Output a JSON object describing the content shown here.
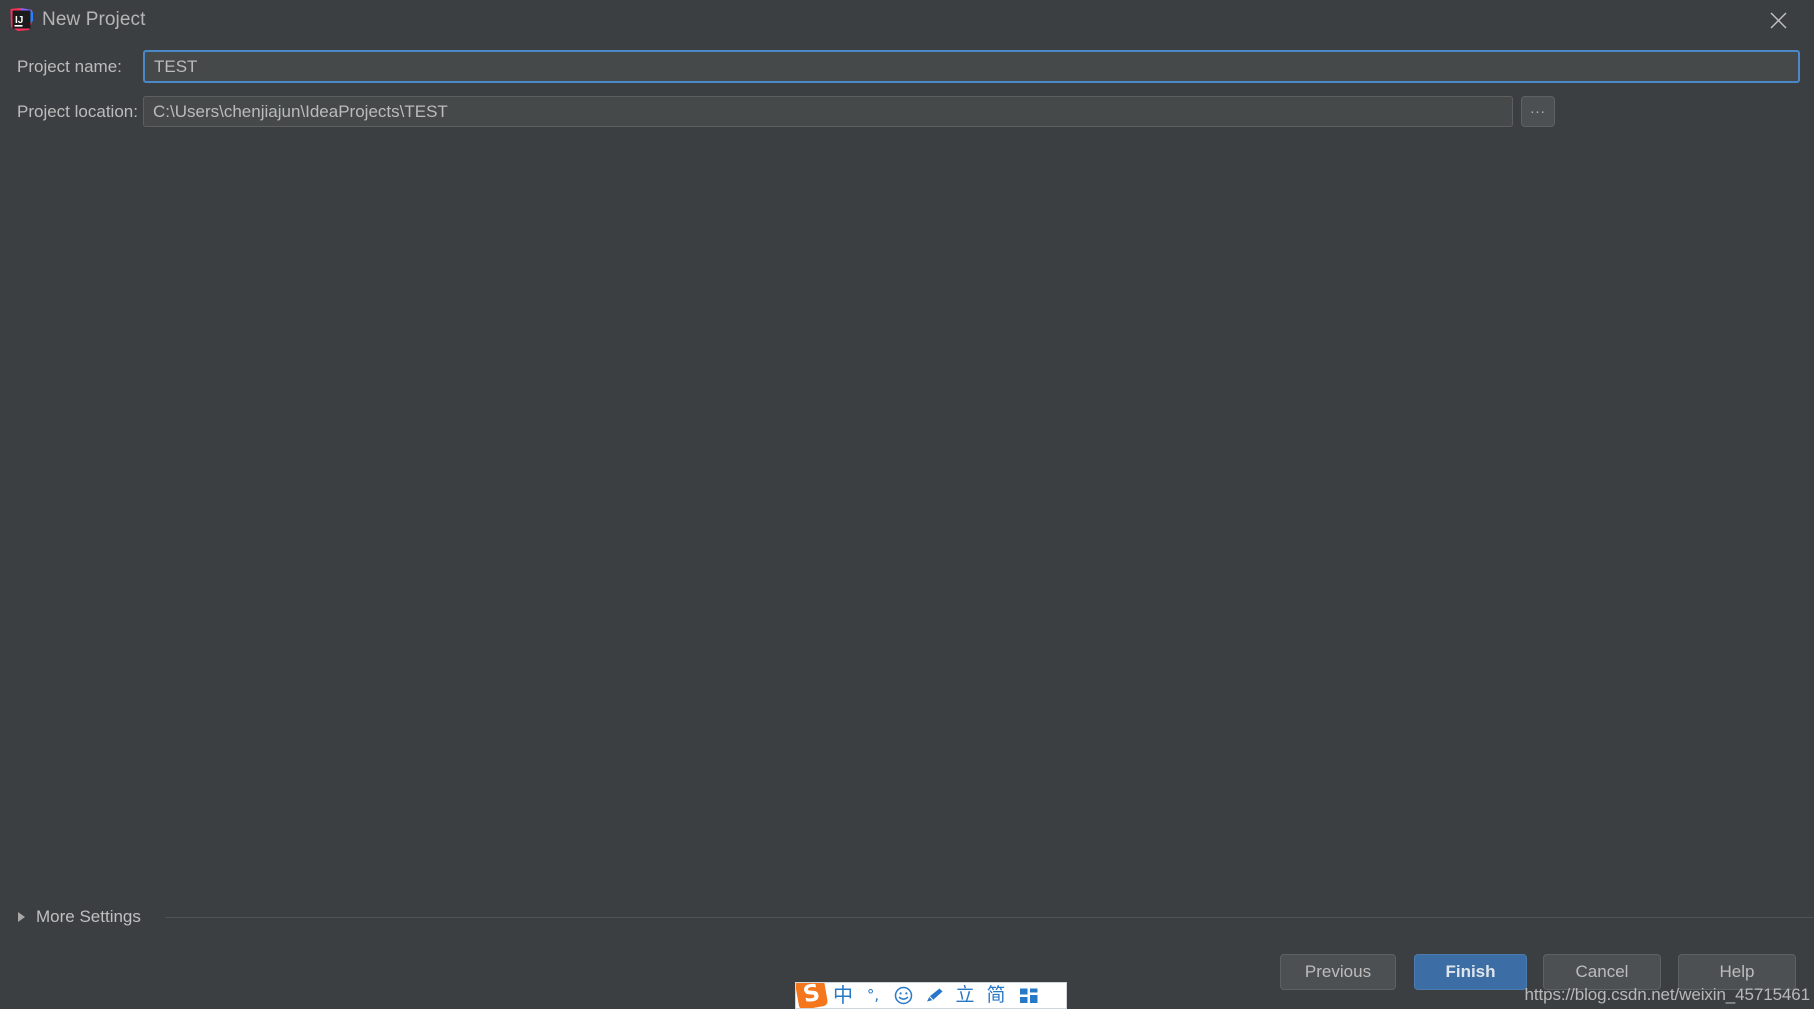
{
  "window": {
    "title": "New Project",
    "app_icon": "intellij-idea-icon",
    "close_icon": "close-icon",
    "background_color": "#3c3f41"
  },
  "form": {
    "name_field": {
      "label": "Project name:",
      "value": "TEST",
      "placeholder": "",
      "focused": true,
      "focus_color": "#4a88c7"
    },
    "location_field": {
      "label": "Project location:",
      "value": "C:\\Users\\chenjiajun\\IdeaProjects\\TEST",
      "placeholder": "",
      "focused": false
    },
    "browse_button": {
      "label": "...",
      "icon": "ellipsis-icon"
    }
  },
  "more_settings": {
    "label": "More Settings",
    "expanded": false,
    "chevron_icon": "triangle-right-icon"
  },
  "footer": {
    "previous_label": "Previous",
    "finish_label": "Finish",
    "cancel_label": "Cancel",
    "help_label": "Help",
    "default_button": "Finish",
    "finish_color": "#3c6ea5"
  },
  "watermark": {
    "text": "https://blog.csdn.net/weixin_45715461"
  },
  "ime_toolbar": {
    "logo": "sogou-logo-icon",
    "items": [
      {
        "icon": "chinese-mode-icon",
        "glyph": "中"
      },
      {
        "icon": "punctuation-mode-icon",
        "glyph": "°,"
      },
      {
        "icon": "emoji-icon",
        "glyph": "☺"
      },
      {
        "icon": "handwriting-pencil-icon",
        "glyph": ""
      },
      {
        "icon": "keyboard-layout-icon",
        "glyph": "立"
      },
      {
        "icon": "simplified-chinese-icon",
        "glyph": "简"
      },
      {
        "icon": "toolbox-grid-icon",
        "glyph": ""
      }
    ]
  }
}
